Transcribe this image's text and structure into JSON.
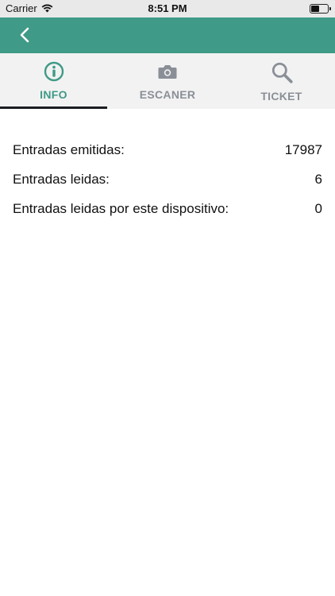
{
  "status": {
    "carrier": "Carrier",
    "time": "8:51 PM",
    "battery_level": 0.45
  },
  "nav": {
    "back_icon": "chevron-left-icon"
  },
  "colors": {
    "brand": "#3f9a87",
    "tab_inactive": "#8a8f97",
    "indicator": "#1b1d22"
  },
  "tabs": [
    {
      "label": "INFO",
      "icon": "info-icon",
      "active": true
    },
    {
      "label": "ESCANER",
      "icon": "camera-icon",
      "active": false
    },
    {
      "label": "TICKET",
      "icon": "search-icon",
      "active": false
    }
  ],
  "stats": [
    {
      "label": "Entradas emitidas:",
      "value": "17987"
    },
    {
      "label": "Entradas leidas:",
      "value": "6"
    },
    {
      "label": "Entradas leidas por este dispositivo:",
      "value": "0"
    }
  ]
}
